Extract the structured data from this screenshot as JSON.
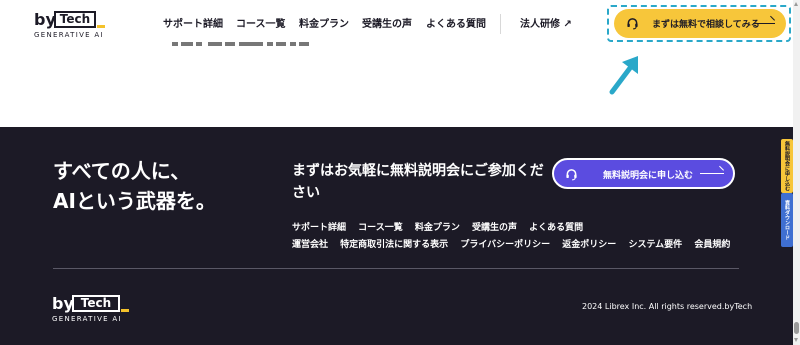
{
  "header": {
    "logo": {
      "by": "by",
      "tech": "Tech",
      "tagline": "GENERATIVE AI"
    },
    "nav": [
      {
        "label": "サポート詳細"
      },
      {
        "label": "コース一覧"
      },
      {
        "label": "料金プラン"
      },
      {
        "label": "受講生の声"
      },
      {
        "label": "よくある質問"
      },
      {
        "label": "法人研修 ↗"
      }
    ],
    "cta": {
      "label": "まずは無料で相談してみる",
      "icon": "headset-icon"
    }
  },
  "footer": {
    "tagline_line1": "すべての人に、",
    "tagline_line2": "AIという武器を。",
    "invite_text": "まずはお気軽に無料説明会にご参加ください",
    "apply_button": {
      "label": "無料説明会に申し込む",
      "icon": "headset-icon"
    },
    "links_row1": [
      "サポート詳細",
      "コース一覧",
      "料金プラン",
      "受講生の声",
      "よくある質問"
    ],
    "links_row2": [
      "運営会社",
      "特定商取引法に関する表示",
      "プライバシーポリシー",
      "返金ポリシー",
      "システム要件",
      "会員規約"
    ],
    "logo": {
      "by": "by",
      "tech": "Tech",
      "tagline": "GENERATIVE AI"
    },
    "copyright": "2024 Librex Inc. All rights reserved.byTech"
  },
  "side_tabs": [
    {
      "label": "無料説明会に申し込む",
      "color": "#f7c63a"
    },
    {
      "label": "資料ダウンロード",
      "color": "#3f6fd1"
    }
  ],
  "colors": {
    "accent_yellow": "#f7c63a",
    "footer_bg": "#1c1a26",
    "button_purple": "#5b4ce0",
    "highlight_teal": "#2aa8c9"
  }
}
